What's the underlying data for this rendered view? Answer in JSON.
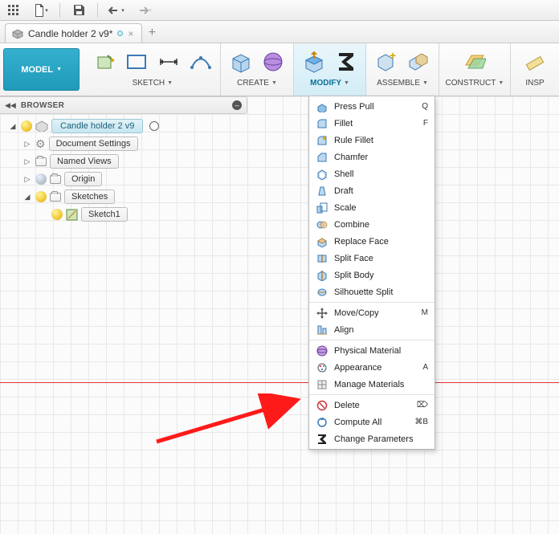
{
  "qat": {},
  "tab": {
    "title": "Candle holder 2 v9*"
  },
  "ribbon": {
    "model": "MODEL",
    "groups": {
      "sketch": {
        "label": "SKETCH"
      },
      "create": {
        "label": "CREATE"
      },
      "modify": {
        "label": "MODIFY"
      },
      "assemble": {
        "label": "ASSEMBLE"
      },
      "construct": {
        "label": "CONSTRUCT"
      },
      "inspect": {
        "label": "INSP"
      }
    }
  },
  "browser": {
    "title": "BROWSER",
    "root": "Candle holder 2 v9",
    "nodes": {
      "docSettings": "Document Settings",
      "namedViews": "Named Views",
      "origin": "Origin",
      "sketches": "Sketches",
      "sketch1": "Sketch1"
    }
  },
  "menu": {
    "items": [
      {
        "id": "press-pull",
        "label": "Press Pull",
        "shortcut": "Q"
      },
      {
        "id": "fillet",
        "label": "Fillet",
        "shortcut": "F"
      },
      {
        "id": "rule-fillet",
        "label": "Rule Fillet"
      },
      {
        "id": "chamfer",
        "label": "Chamfer"
      },
      {
        "id": "shell",
        "label": "Shell"
      },
      {
        "id": "draft",
        "label": "Draft"
      },
      {
        "id": "scale",
        "label": "Scale"
      },
      {
        "id": "combine",
        "label": "Combine"
      },
      {
        "id": "replace-face",
        "label": "Replace Face"
      },
      {
        "id": "split-face",
        "label": "Split Face"
      },
      {
        "id": "split-body",
        "label": "Split Body"
      },
      {
        "id": "silhouette-split",
        "label": "Silhouette Split"
      },
      {
        "sep": true
      },
      {
        "id": "move-copy",
        "label": "Move/Copy",
        "shortcut": "M"
      },
      {
        "id": "align",
        "label": "Align"
      },
      {
        "sep": true
      },
      {
        "id": "physical-material",
        "label": "Physical Material"
      },
      {
        "id": "appearance",
        "label": "Appearance",
        "shortcut": "A"
      },
      {
        "id": "manage-materials",
        "label": "Manage Materials"
      },
      {
        "sep": true
      },
      {
        "id": "delete",
        "label": "Delete",
        "shortcut": "⌦"
      },
      {
        "id": "compute-all",
        "label": "Compute All",
        "shortcut": "⌘B"
      },
      {
        "id": "change-parameters",
        "label": "Change Parameters"
      }
    ]
  }
}
